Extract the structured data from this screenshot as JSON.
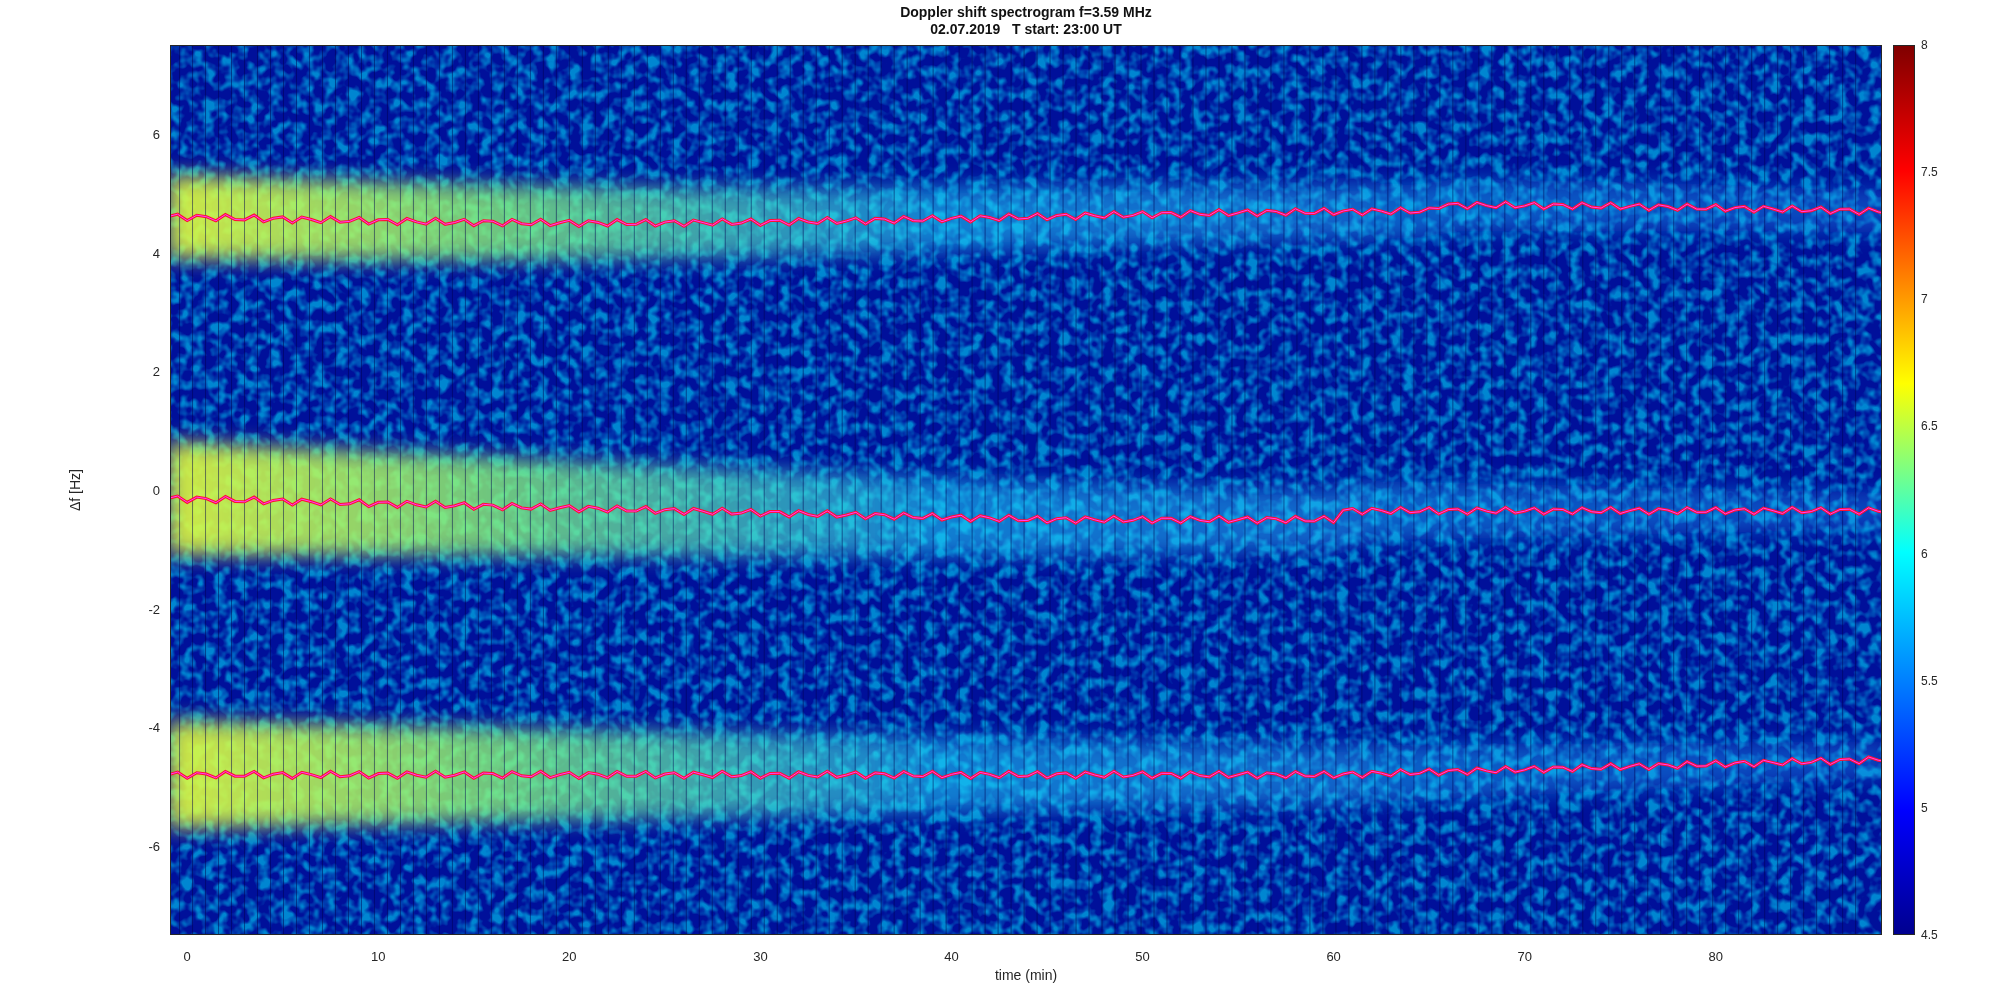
{
  "title": {
    "line_1": "Doppler shift spectrogram f=3.59 MHz",
    "line_2": "02.07.2019   T start: 23:00 UT"
  },
  "y_axis": {
    "label": "Δf [Hz]",
    "ticks": [
      "6",
      "4",
      "2",
      "0",
      "-2",
      "-4",
      "-6"
    ]
  },
  "x_axis": {
    "label": "time (min)",
    "ticks": [
      "0",
      "10",
      "20",
      "30",
      "40",
      "50",
      "60",
      "70",
      "80"
    ]
  },
  "colorbar": {
    "ticks": [
      "8",
      "7.5",
      "7",
      "6.5",
      "6",
      "5.5",
      "5",
      "4.5"
    ]
  }
}
